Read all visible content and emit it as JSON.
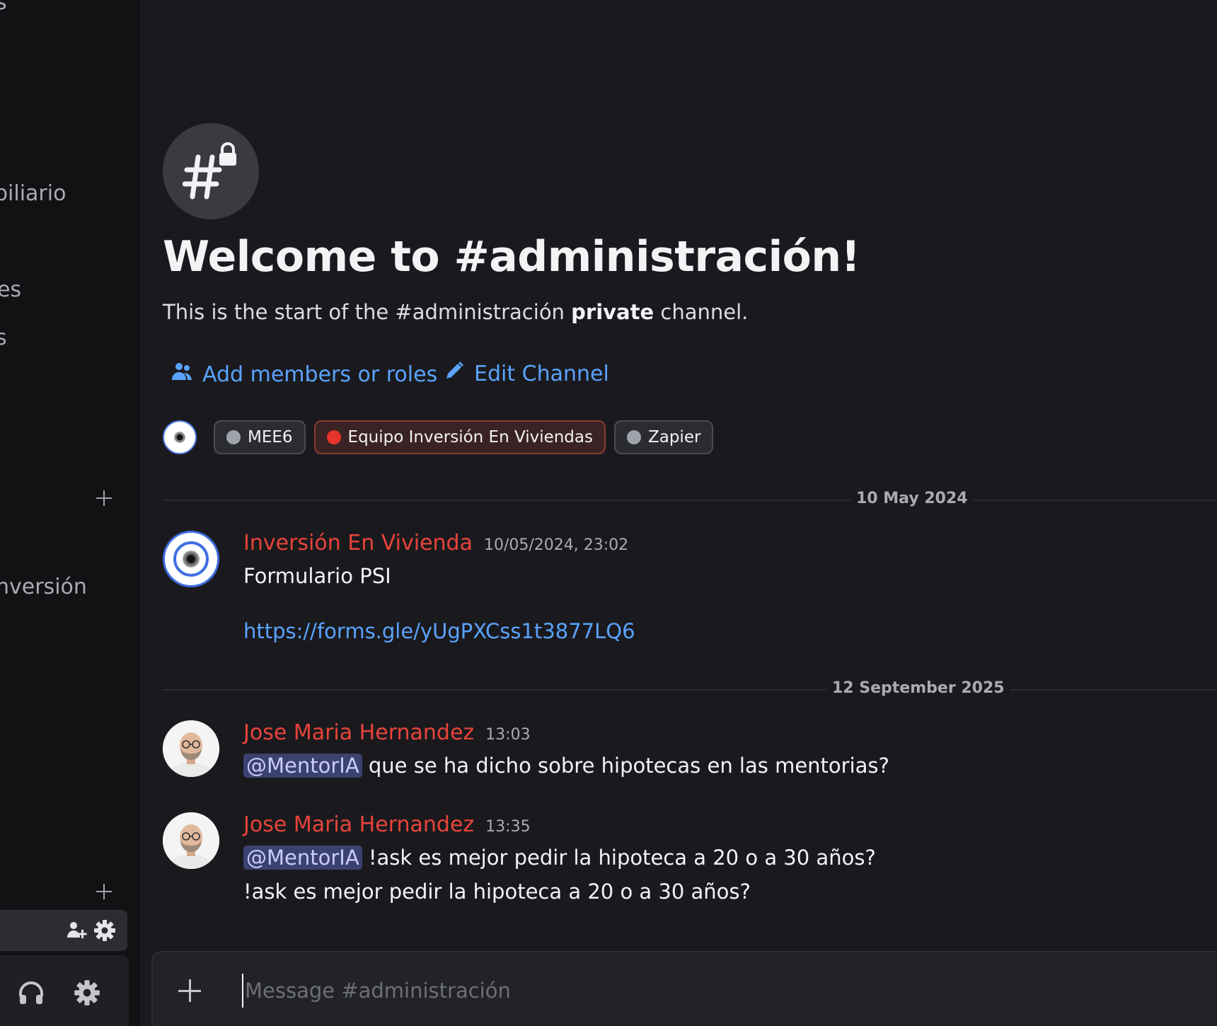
{
  "sidebar": {
    "fragments": [
      "s",
      "biliario",
      "es",
      "s",
      "nversión"
    ]
  },
  "channel": {
    "welcome_title": "Welcome to #administración!",
    "subtitle_prefix": "This is the start of the #administración ",
    "subtitle_bold": "private",
    "subtitle_suffix": " channel.",
    "add_members_label": "Add members or roles",
    "edit_channel_label": "Edit Channel"
  },
  "roles": [
    {
      "name": "MEE6",
      "color": "#9ea3ab"
    },
    {
      "name": "Equipo Inversión En Viviendas",
      "color": "#e8332b"
    },
    {
      "name": "Zapier",
      "color": "#9ea3ab"
    }
  ],
  "dates": [
    "10 May 2024",
    "12 September 2025"
  ],
  "messages": [
    {
      "author": "Inversión En Vivienda",
      "time": "10/05/2024, 23:02",
      "text": "Formulario PSI",
      "link": "https://forms.gle/yUgPXCss1t3877LQ6"
    },
    {
      "author": "Jose Maria Hernandez",
      "time": "13:03",
      "mention": "@MentorIA",
      "text": " que se ha dicho sobre hipotecas en las mentorias?"
    },
    {
      "author": "Jose Maria Hernandez",
      "time": "13:35",
      "mention": "@MentorIA",
      "text": " !ask es mejor pedir la hipoteca a 20 o a 30 años?",
      "text2": "!ask es mejor pedir la hipoteca a 20 o a 30 años?"
    }
  ],
  "composer": {
    "placeholder": "Message #administración"
  },
  "colors": {
    "author": "#e8443a",
    "link": "#5aa3ff",
    "mention_bg": "#3c4270"
  }
}
